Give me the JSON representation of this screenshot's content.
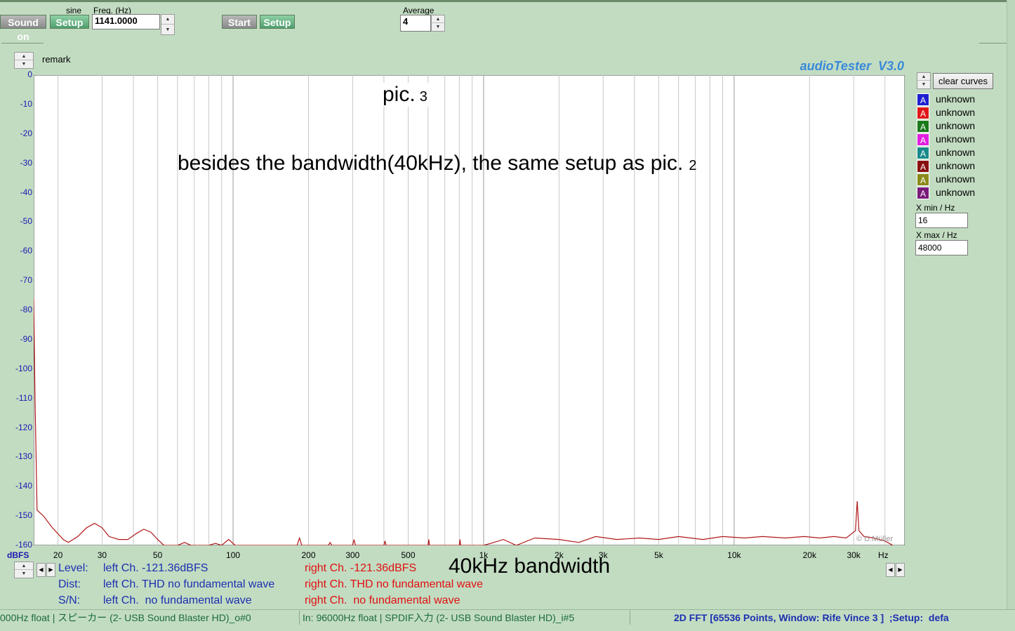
{
  "toolbar": {
    "sound_on_label": "Sound on",
    "sine_label": "sine",
    "setup1_label": "Setup",
    "freq_label": "Freq. (Hz)",
    "freq_value": "1141.0000",
    "start_label": "Start",
    "setup2_label": "Setup",
    "average_label": "Average",
    "average_value": "4"
  },
  "remark_label": "remark",
  "app_title": "audioTester  V3.0",
  "annotations": {
    "pic_title": "pic.",
    "pic_number": "3",
    "note": "besides the bandwidth(40kHz), the same setup as pic.",
    "note_number": "2",
    "bandwidth": "40kHz bandwidth",
    "watermark": "© U.Müller"
  },
  "chart_data": {
    "type": "line",
    "xscale": "log",
    "xlim": [
      16,
      48000
    ],
    "ylim": [
      -160,
      0
    ],
    "xunit": "Hz",
    "yunit": "dBFS",
    "grid": true,
    "yticks": [
      "0",
      "-10",
      "-20",
      "-30",
      "-40",
      "-50",
      "-60",
      "-70",
      "-80",
      "-90",
      "-100",
      "-110",
      "-120",
      "-130",
      "-140",
      "-150",
      "-160"
    ],
    "xticks": [
      {
        "v": 20,
        "t": "20"
      },
      {
        "v": 30,
        "t": "30"
      },
      {
        "v": 50,
        "t": "50"
      },
      {
        "v": 100,
        "t": "100"
      },
      {
        "v": 200,
        "t": "200"
      },
      {
        "v": 300,
        "t": "300"
      },
      {
        "v": 500,
        "t": "500"
      },
      {
        "v": 1000,
        "t": "1k"
      },
      {
        "v": 2000,
        "t": "2k"
      },
      {
        "v": 3000,
        "t": "3k"
      },
      {
        "v": 5000,
        "t": "5k"
      },
      {
        "v": 10000,
        "t": "10k"
      },
      {
        "v": 20000,
        "t": "20k"
      },
      {
        "v": 30000,
        "t": "30k"
      }
    ],
    "series": [
      {
        "color": "#b01818",
        "points": [
          [
            16,
            -76
          ],
          [
            16.2,
            -110
          ],
          [
            16.5,
            -148
          ],
          [
            17.5,
            -150
          ],
          [
            19,
            -154
          ],
          [
            21,
            -158
          ],
          [
            22,
            -159
          ],
          [
            24,
            -157
          ],
          [
            26,
            -154
          ],
          [
            28,
            -152.5
          ],
          [
            30,
            -154
          ],
          [
            32,
            -157
          ],
          [
            35,
            -158
          ],
          [
            38,
            -158
          ],
          [
            41,
            -156
          ],
          [
            44,
            -154.5
          ],
          [
            47,
            -155.5
          ],
          [
            50,
            -158
          ],
          [
            53,
            -160
          ],
          [
            60,
            -160
          ],
          [
            64,
            -159
          ],
          [
            68,
            -160
          ],
          [
            80,
            -160
          ],
          [
            85,
            -159.3
          ],
          [
            90,
            -160
          ],
          [
            96,
            -158
          ],
          [
            102,
            -160
          ],
          [
            180,
            -160
          ],
          [
            184,
            -157.5
          ],
          [
            188,
            -160
          ],
          [
            240,
            -160
          ],
          [
            244,
            -159
          ],
          [
            248,
            -160
          ],
          [
            300,
            -160
          ],
          [
            304,
            -158
          ],
          [
            308,
            -160
          ],
          [
            400,
            -160
          ],
          [
            404,
            -158.5
          ],
          [
            408,
            -160
          ],
          [
            600,
            -160
          ],
          [
            604,
            -158
          ],
          [
            608,
            -160
          ],
          [
            800,
            -160
          ],
          [
            805,
            -158
          ],
          [
            810,
            -160
          ],
          [
            1000,
            -160
          ],
          [
            1100,
            -159
          ],
          [
            1200,
            -158
          ],
          [
            1350,
            -160
          ],
          [
            1600,
            -157.5
          ],
          [
            2000,
            -158
          ],
          [
            2400,
            -159
          ],
          [
            2800,
            -157
          ],
          [
            3400,
            -158
          ],
          [
            4200,
            -157.5
          ],
          [
            5000,
            -158
          ],
          [
            6000,
            -157
          ],
          [
            7500,
            -158
          ],
          [
            9000,
            -157
          ],
          [
            11000,
            -157.5
          ],
          [
            13000,
            -157
          ],
          [
            16000,
            -157.5
          ],
          [
            19000,
            -157
          ],
          [
            22000,
            -157.5
          ],
          [
            25000,
            -157
          ],
          [
            28000,
            -157.5
          ],
          [
            30500,
            -155
          ],
          [
            31000,
            -145
          ],
          [
            31500,
            -155
          ],
          [
            33000,
            -157
          ],
          [
            36000,
            -157.5
          ],
          [
            40000,
            -158.5
          ],
          [
            43000,
            -160
          ]
        ]
      }
    ]
  },
  "legend": [
    {
      "letter": "A",
      "color": "#1f1fd0",
      "label": "unknown"
    },
    {
      "letter": "A",
      "color": "#e01818",
      "label": "unknown"
    },
    {
      "letter": "A",
      "color": "#1a7a1a",
      "label": "unknown"
    },
    {
      "letter": "A",
      "color": "#e020e0",
      "label": "unknown"
    },
    {
      "letter": "A",
      "color": "#1a8a8a",
      "label": "unknown"
    },
    {
      "letter": "A",
      "color": "#8a1010",
      "label": "unknown"
    },
    {
      "letter": "A",
      "color": "#8a8a1a",
      "label": "unknown"
    },
    {
      "letter": "A",
      "color": "#7a1a7a",
      "label": "unknown"
    }
  ],
  "right_panel": {
    "clear_curves": "clear curves",
    "xmin_label": "X min / Hz",
    "xmin_value": "16",
    "xmax_label": "X max / Hz",
    "xmax_value": "48000"
  },
  "axis": {
    "yunit_label": "dBFS",
    "xunit_label": "Hz"
  },
  "info": {
    "level_label": "Level:",
    "level_left": "left Ch. -121.36dBFS",
    "level_right": "right Ch. -121.36dBFS",
    "dist_label": "Dist:",
    "dist_left": "left Ch. THD no fundamental wave",
    "dist_right": "right Ch. THD no fundamental wave",
    "sn_label": "S/N:",
    "sn_left": "left Ch.  no fundamental wave",
    "sn_right": "right Ch.  no fundamental wave"
  },
  "status": {
    "out": "000Hz float  | スピーカー (2- USB Sound Blaster HD)_o#0",
    "in": "In: 96000Hz float  | SPDIF入力 (2- USB Sound Blaster HD)_i#5",
    "fft": "2D FFT [65536 Points, Window: Rife Vince 3 ]  ;Setup:  defa"
  }
}
